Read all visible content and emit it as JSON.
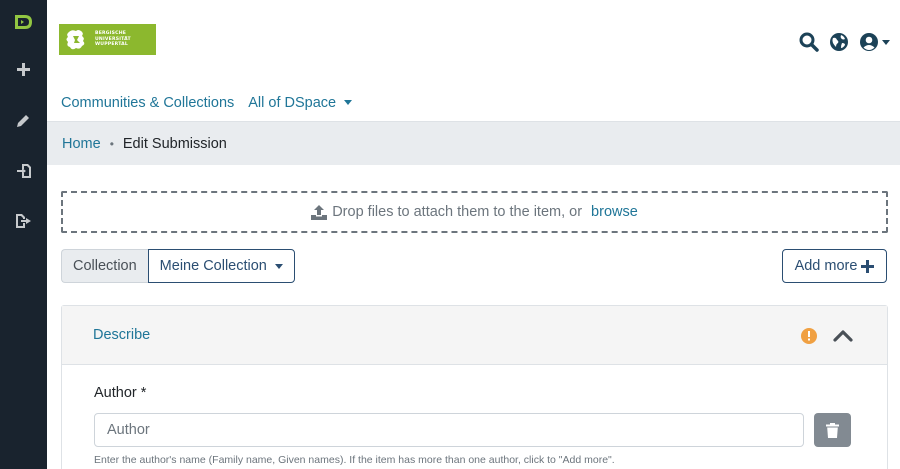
{
  "logo": {
    "lines": [
      "BERGISCHE",
      "UNIVERSITÄT",
      "WUPPERTAL"
    ],
    "color": "#8cb82e"
  },
  "header": {
    "icons": [
      "search-icon",
      "globe-icon",
      "user-circle-icon"
    ]
  },
  "nav": {
    "communities": "Communities & Collections",
    "all_dspace": "All of DSpace"
  },
  "breadcrumb": {
    "home": "Home",
    "separator": "•",
    "current": "Edit Submission"
  },
  "dropzone": {
    "text": "Drop files to attach them to the item, or",
    "browse": "browse"
  },
  "collection": {
    "label": "Collection",
    "selected": "Meine Collection"
  },
  "add_more": {
    "label": "Add more"
  },
  "section": {
    "title": "Describe",
    "status": "warning"
  },
  "author_field": {
    "label": "Author *",
    "placeholder": "Author",
    "value": "",
    "help": "Enter the author's name (Family name, Given names). If the item has more than one author, click to \"Add more\"."
  },
  "colors": {
    "sidebar": "#19232e",
    "sidebar_accent": "#92c642",
    "link": "#207698",
    "primary": "#2b4e72",
    "warning": "#f0a042"
  }
}
